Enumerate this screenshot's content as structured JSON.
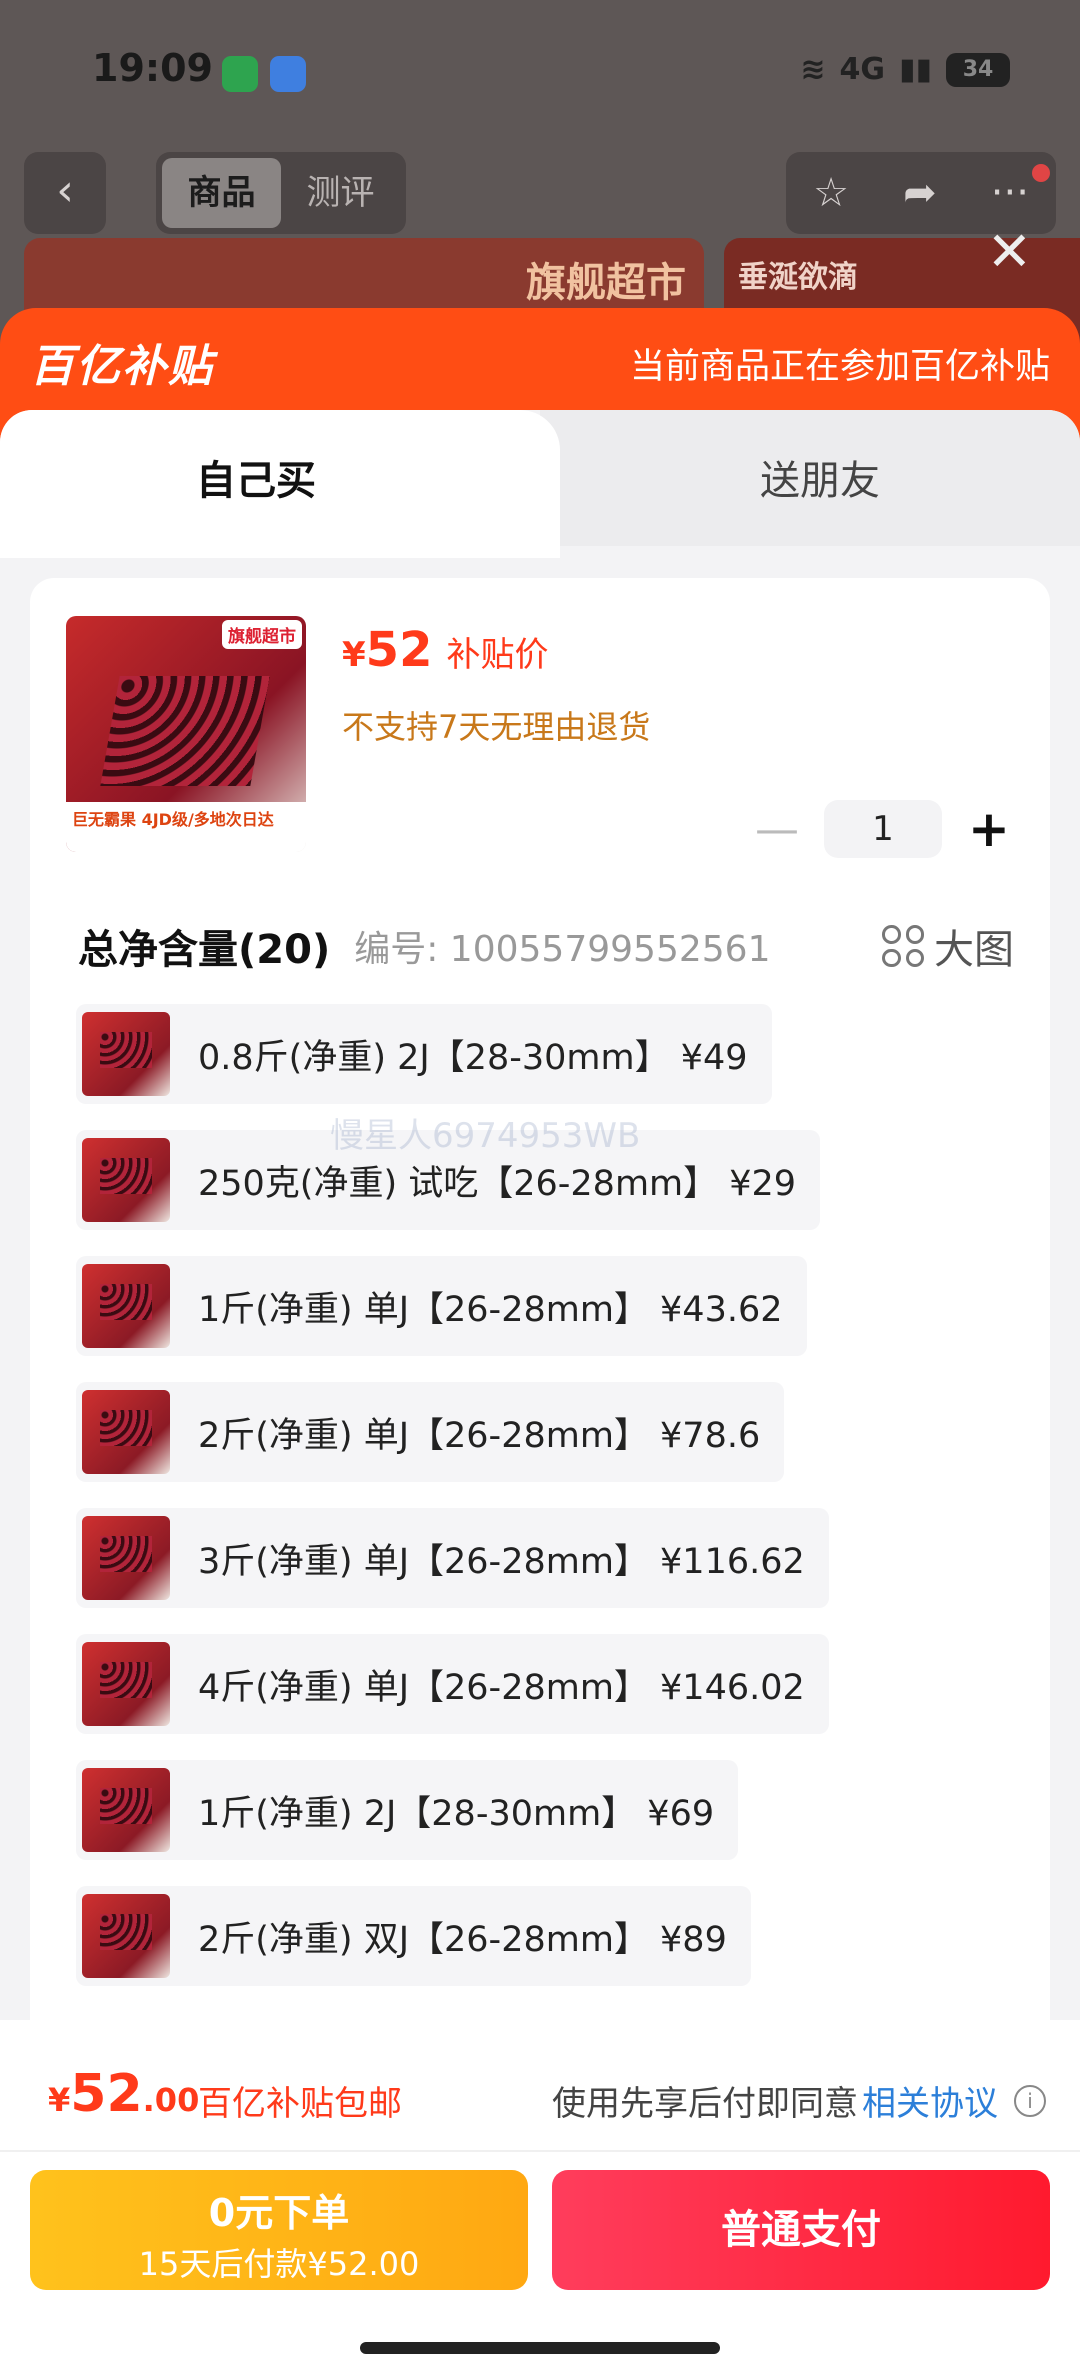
{
  "status": {
    "time": "19:09",
    "network": "4G",
    "battery": "34"
  },
  "topbar": {
    "back_icon": "chevron-left-icon",
    "tabs": [
      "商品",
      "测评"
    ],
    "active_tab": 0
  },
  "background": {
    "banner1_text": "旗舰超市",
    "banner2_text": "垂涎欲滴"
  },
  "subsidy": {
    "logo": "百亿补贴",
    "note": "当前商品正在参加百亿补贴"
  },
  "mode_tabs": {
    "self": "自己买",
    "gift": "送朋友"
  },
  "product": {
    "thumb_tag": "旗舰超市",
    "thumb_footer": "巨无霸果 4JD级/多地次日达",
    "price_currency": "¥",
    "price": "52",
    "price_label": "补贴价",
    "return_policy": "不支持7天无理由退货",
    "quantity": "1"
  },
  "spec": {
    "title": "总净含量(20)",
    "code": "编号: 10055799552561",
    "big_image_label": "大图",
    "options": [
      "0.8斤(净重) 2J【28-30mm】 ¥49",
      "250克(净重) 试吃【26-28mm】 ¥29",
      "1斤(净重) 单J【26-28mm】 ¥43.62",
      "2斤(净重) 单J【26-28mm】 ¥78.6",
      "3斤(净重) 单J【26-28mm】 ¥116.62",
      "4斤(净重) 单J【26-28mm】 ¥146.02",
      "1斤(净重) 2J【28-30mm】 ¥69",
      "2斤(净重) 双J【26-28mm】 ¥89"
    ]
  },
  "watermark": "慢星人6974953WB",
  "footer": {
    "currency": "¥",
    "total_int": "52",
    "total_dec": ".00",
    "total_note": "百亿补贴包邮",
    "agree_prefix": "使用先享后付即同意",
    "agree_link": "相关协议",
    "btn_later_line1": "0元下单",
    "btn_later_line2": "15天后付款¥52.00",
    "btn_pay": "普通支付"
  },
  "colors": {
    "accent": "#ff3a1a",
    "subsidy": "#ff4d14",
    "pay": "#ff1a2e",
    "later": "#ffb414",
    "link": "#2c7fd9"
  }
}
